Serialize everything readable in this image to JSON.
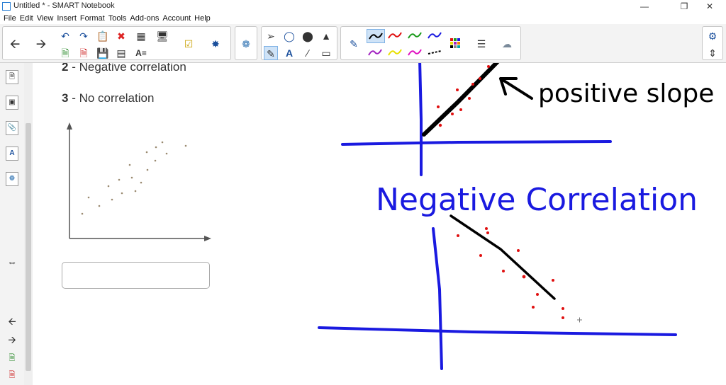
{
  "window": {
    "title": "Untitled * - SMART Notebook"
  },
  "menu": [
    "File",
    "Edit",
    "View",
    "Insert",
    "Format",
    "Tools",
    "Add-ons",
    "Account",
    "Help"
  ],
  "canvas": {
    "item2_num": "2",
    "item2_text": "- Negative correlation",
    "item3_num": "3",
    "item3_text": "- No correlation",
    "annotation_positive": "positive slope",
    "heading_negative": "Negative Correlation"
  },
  "colors": {
    "ink_blue": "#1a1ae0",
    "ink_red": "#e01010",
    "ink_black": "#000000",
    "accent": "#7fb2e5"
  }
}
